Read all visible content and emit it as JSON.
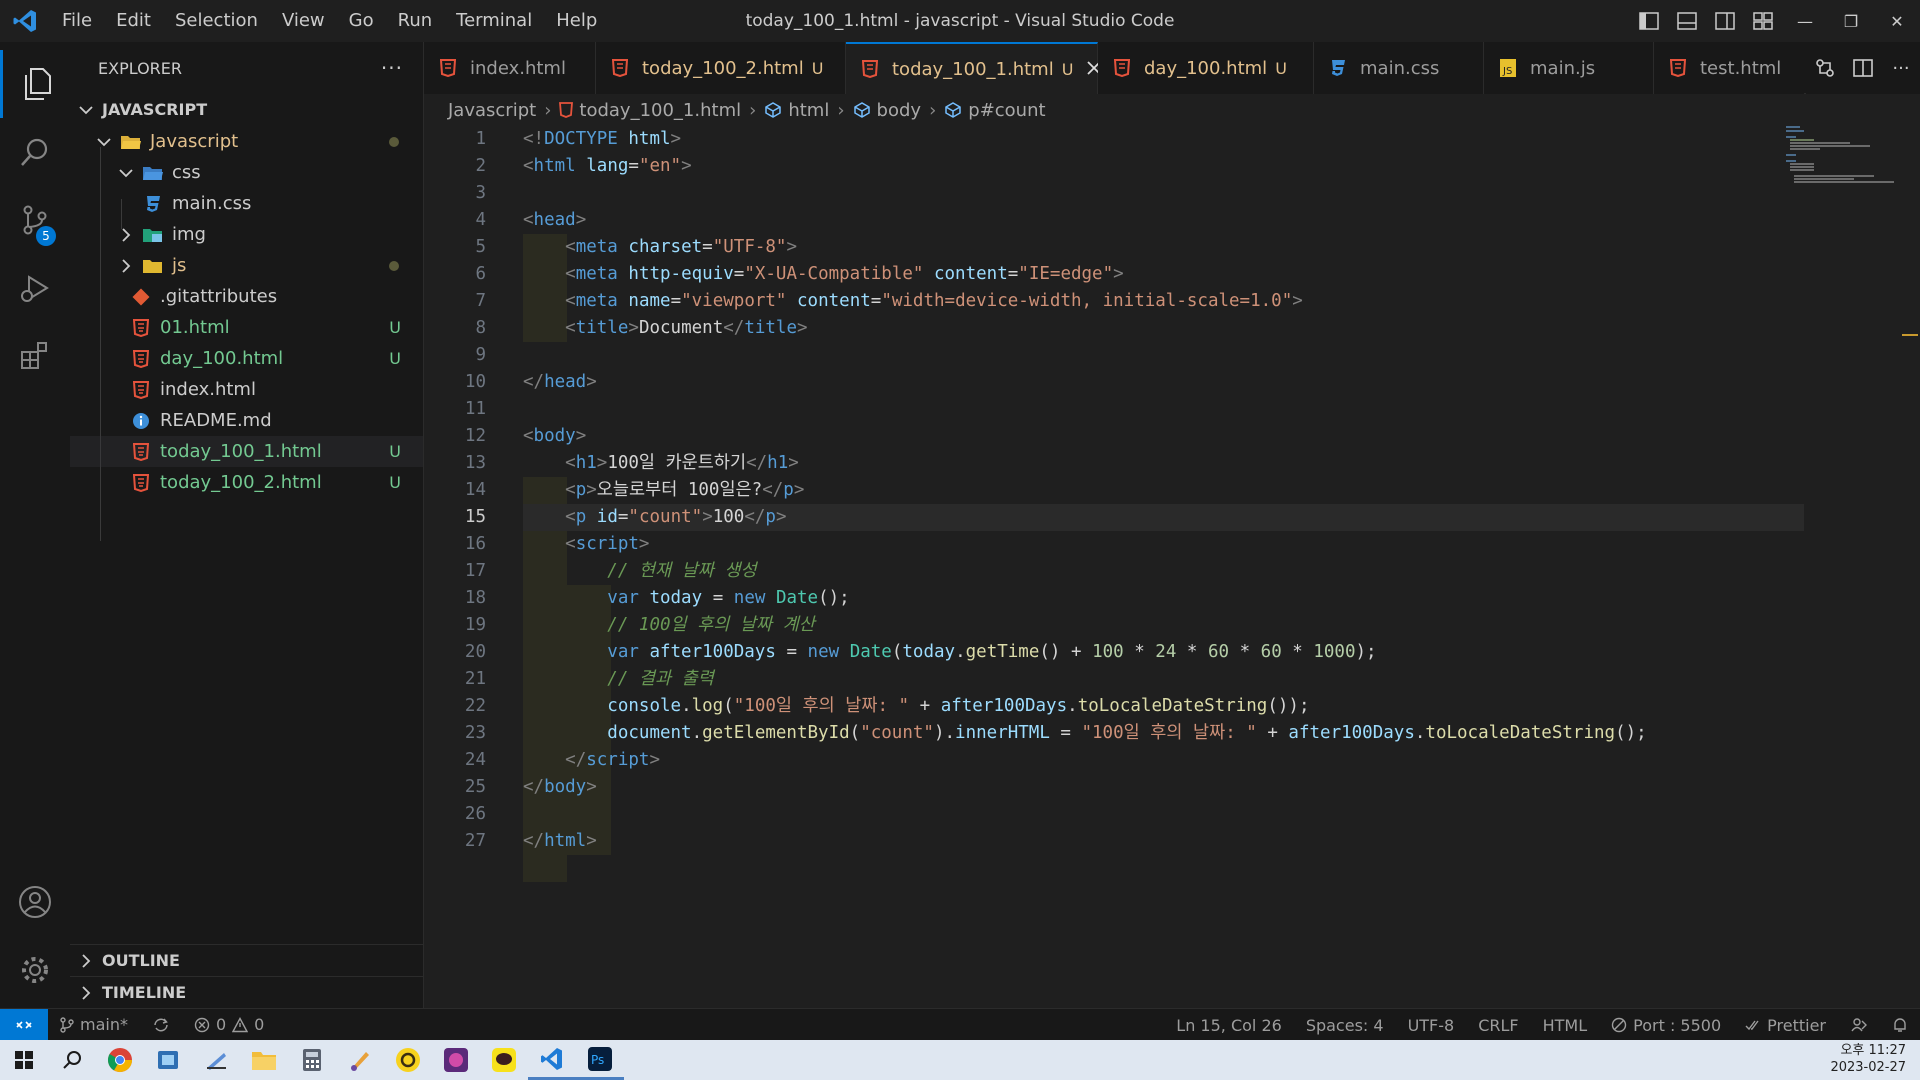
{
  "titlebar": {
    "menus": [
      "File",
      "Edit",
      "Selection",
      "View",
      "Go",
      "Run",
      "Terminal",
      "Help"
    ],
    "window_title": "today_100_1.html - javascript - Visual Studio Code"
  },
  "activity": {
    "scm_badge": "5"
  },
  "sidebar": {
    "title": "EXPLORER",
    "more": "···",
    "root": "JAVASCRIPT",
    "items": [
      {
        "label": "Javascript",
        "status": ""
      },
      {
        "label": "css",
        "status": ""
      },
      {
        "label": "main.css",
        "status": ""
      },
      {
        "label": "img",
        "status": ""
      },
      {
        "label": "js",
        "status": ""
      },
      {
        "label": ".gitattributes",
        "status": ""
      },
      {
        "label": "01.html",
        "status": "U"
      },
      {
        "label": "day_100.html",
        "status": "U"
      },
      {
        "label": "index.html",
        "status": ""
      },
      {
        "label": "README.md",
        "status": ""
      },
      {
        "label": "today_100_1.html",
        "status": "U"
      },
      {
        "label": "today_100_2.html",
        "status": "U"
      }
    ],
    "outline": "OUTLINE",
    "timeline": "TIMELINE"
  },
  "tabs": [
    {
      "label": "index.html",
      "mod": ""
    },
    {
      "label": "today_100_2.html",
      "mod": "U"
    },
    {
      "label": "today_100_1.html",
      "mod": "U"
    },
    {
      "label": "day_100.html",
      "mod": "U"
    },
    {
      "label": "main.css",
      "mod": ""
    },
    {
      "label": "main.js",
      "mod": ""
    },
    {
      "label": "test.html",
      "mod": ""
    }
  ],
  "breadcrumb": [
    "Javascript",
    "today_100_1.html",
    "html",
    "body",
    "p#count"
  ],
  "editor": {
    "line_numbers": [
      "1",
      "2",
      "3",
      "4",
      "5",
      "6",
      "7",
      "8",
      "9",
      "10",
      "11",
      "12",
      "13",
      "14",
      "15",
      "16",
      "17",
      "18",
      "19",
      "20",
      "21",
      "22",
      "23",
      "24",
      "25",
      "26",
      "27"
    ],
    "current_line": 15,
    "tokens": {
      "doctype": "DOCTYPE",
      "html": "html",
      "lang": "lang",
      "en": "\"en\"",
      "head": "head",
      "meta": "meta",
      "charset": "charset",
      "utf8": "\"UTF-8\"",
      "http_equiv": "http-equiv",
      "xua": "\"X-UA-Compatible\"",
      "content": "content",
      "ieedge": "\"IE=edge\"",
      "name": "name",
      "viewport": "\"viewport\"",
      "viewport_val": "\"width=device-width, initial-scale=1.0\"",
      "title": "title",
      "title_text": "Document",
      "body": "body",
      "h1": "h1",
      "h1_text": "100일 카운트하기",
      "p": "p",
      "p_text": "오늘로부터 100일은?",
      "id": "id",
      "count": "\"count\"",
      "p2_text": "100",
      "script": "script",
      "c1": "// 현재 날짜 생성",
      "var": "var",
      "today": "today",
      "new": "new",
      "Date": "Date",
      "c2": "// 100일 후의 날짜 계산",
      "after": "after100Days",
      "getTime": "getTime",
      "n100": "100",
      "n24": "24",
      "n60": "60",
      "n1000": "1000",
      "c3": "// 결과 출력",
      "console": "console",
      "log": "log",
      "str1": "\"100일 후의 날짜: \"",
      "toLocale": "toLocaleDateString",
      "document": "document",
      "getById": "getElementById",
      "countq": "\"count\"",
      "innerHTML": "innerHTML"
    }
  },
  "statusbar": {
    "branch": "main*",
    "errors": "0",
    "warnings": "0",
    "position": "Ln 15, Col 26",
    "spaces": "Spaces: 4",
    "encoding": "UTF-8",
    "eol": "CRLF",
    "language": "HTML",
    "port": "Port : 5500",
    "prettier": "Prettier"
  },
  "taskbar": {
    "time": "오후 11:27",
    "date": "2023-02-27"
  }
}
